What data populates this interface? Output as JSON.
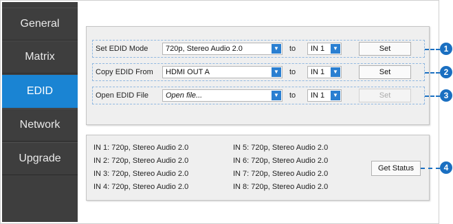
{
  "nav": {
    "items": [
      {
        "label": "General"
      },
      {
        "label": "Matrix"
      },
      {
        "label": "EDID"
      },
      {
        "label": "Network"
      },
      {
        "label": "Upgrade"
      }
    ],
    "active": "EDID"
  },
  "edid": {
    "rows": [
      {
        "label": "Set EDID Mode",
        "source": "720p, Stereo Audio 2.0",
        "to": "to",
        "target": "IN 1",
        "button": "Set",
        "button_enabled": true,
        "callout": "1"
      },
      {
        "label": "Copy EDID From",
        "source": "HDMI OUT A",
        "to": "to",
        "target": "IN 1",
        "button": "Set",
        "button_enabled": true,
        "callout": "2"
      },
      {
        "label": "Open EDID File",
        "source": "Open file...",
        "to": "to",
        "target": "IN 1",
        "button": "Set",
        "button_enabled": false,
        "callout": "3"
      }
    ]
  },
  "status": {
    "left": [
      "IN 1: 720p, Stereo Audio 2.0",
      "IN 2: 720p, Stereo Audio 2.0",
      "IN 3: 720p, Stereo Audio 2.0",
      "IN 4: 720p, Stereo Audio 2.0"
    ],
    "right": [
      "IN 5: 720p, Stereo Audio 2.0",
      "IN 6: 720p, Stereo Audio 2.0",
      "IN 7: 720p, Stereo Audio 2.0",
      "IN 8: 720p, Stereo Audio 2.0"
    ],
    "button": "Get Status",
    "callout": "4"
  },
  "colors": {
    "accent": "#1a84d3",
    "callout": "#1a6fc1",
    "sidebar": "#3e3e3e"
  }
}
